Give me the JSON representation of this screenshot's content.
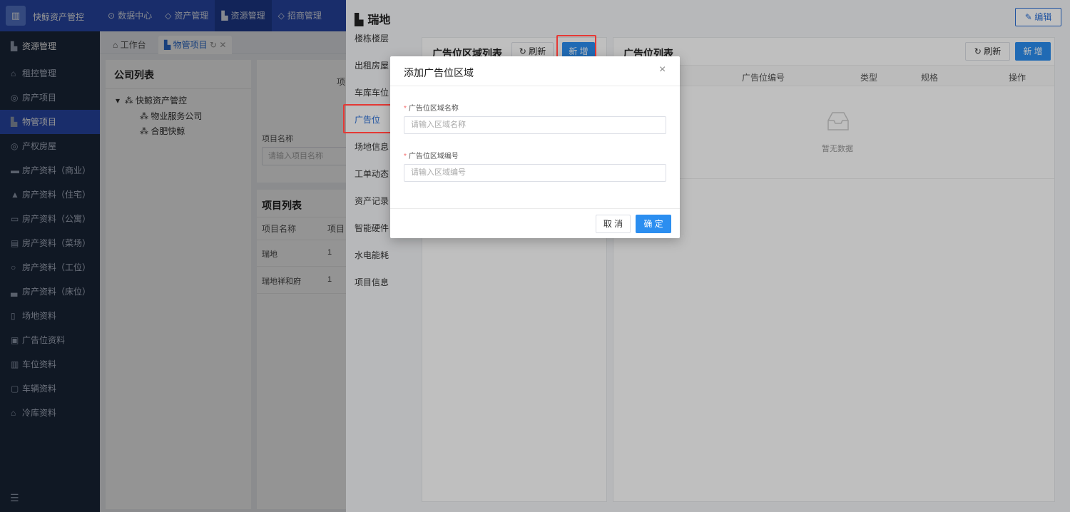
{
  "app": {
    "title": "快鲸资产管控",
    "logo_icon": "building-logo-icon"
  },
  "topnav": [
    {
      "label": "数据中心",
      "icon": "⊙"
    },
    {
      "label": "资产管理",
      "icon": "◇"
    },
    {
      "label": "资源管理",
      "icon": "▙"
    },
    {
      "label": "招商管理",
      "icon": "◇"
    }
  ],
  "sidebar": {
    "header": "资源管理",
    "items": [
      {
        "label": "租控管理",
        "icon": "⌂"
      },
      {
        "label": "房产项目",
        "icon": "◎"
      },
      {
        "label": "物管项目",
        "icon": "▙"
      },
      {
        "label": "产权房屋",
        "icon": "◎"
      },
      {
        "label": "房产资料（商业）",
        "icon": "▬"
      },
      {
        "label": "房产资料（住宅）",
        "icon": "▲"
      },
      {
        "label": "房产资料（公寓）",
        "icon": "▭"
      },
      {
        "label": "房产资料（菜场）",
        "icon": "▤"
      },
      {
        "label": "房产资料（工位）",
        "icon": "○"
      },
      {
        "label": "房产资料（床位）",
        "icon": "▃"
      },
      {
        "label": "场地资料",
        "icon": "▯"
      },
      {
        "label": "广告位资料",
        "icon": "▣"
      },
      {
        "label": "车位资料",
        "icon": "▥"
      },
      {
        "label": "车辆资料",
        "icon": "▢"
      },
      {
        "label": "冷库资料",
        "icon": "⌂"
      }
    ],
    "collapse_icon": "☰"
  },
  "tabs": [
    {
      "label": "工作台",
      "icon": "⌂"
    },
    {
      "label": "物管项目",
      "icon": "▙",
      "refresh": "↻",
      "close": "✕"
    }
  ],
  "company": {
    "title": "公司列表",
    "tree": [
      {
        "label": "快鲸资产管控",
        "level": 0,
        "toggle": "▾",
        "icon": "⁂"
      },
      {
        "label": "物业服务公司",
        "level": 1,
        "icon": "⁂"
      },
      {
        "label": "合肥快鲸",
        "level": 1,
        "icon": "⁂"
      }
    ]
  },
  "project": {
    "top_text": "项",
    "search_label": "项目名称",
    "search_placeholder": "请输入项目名称",
    "list_title": "项目列表",
    "columns": [
      "项目名称",
      "项目"
    ],
    "rows": [
      [
        "瑞地",
        "1"
      ],
      [
        "瑞地祥和府",
        "1"
      ]
    ]
  },
  "drawer": {
    "title": "瑞地",
    "title_icon": "building-icon",
    "edit_label": "编辑",
    "nav": [
      "楼栋楼层",
      "出租房屋",
      "车库车位",
      "广告位",
      "场地信息",
      "工单动态",
      "资产记录",
      "智能硬件",
      "水电能耗",
      "项目信息"
    ],
    "active_nav": "广告位",
    "area_panel": {
      "title": "广告位区域列表",
      "refresh_label": "刷新",
      "add_label": "新 增"
    },
    "ad_panel": {
      "title": "广告位列表",
      "refresh_label": "刷新",
      "add_label": "新 增",
      "columns": [
        "广告位编号",
        "类型",
        "规格",
        "操作"
      ],
      "empty_text": "暂无数据"
    }
  },
  "modal": {
    "title": "添加广告位区域",
    "close_icon": "×",
    "fields": [
      {
        "label": "广告位区域名称",
        "placeholder": "请输入区域名称",
        "value": ""
      },
      {
        "label": "广告位区域编号",
        "placeholder": "请输入区域编号",
        "value": ""
      }
    ],
    "cancel_label": "取 消",
    "ok_label": "确 定"
  },
  "colors": {
    "primary": "#2b8ef0",
    "topbar": "#2b4fb8",
    "sidebar": "#1d2a3f",
    "highlight": "#e53935"
  }
}
